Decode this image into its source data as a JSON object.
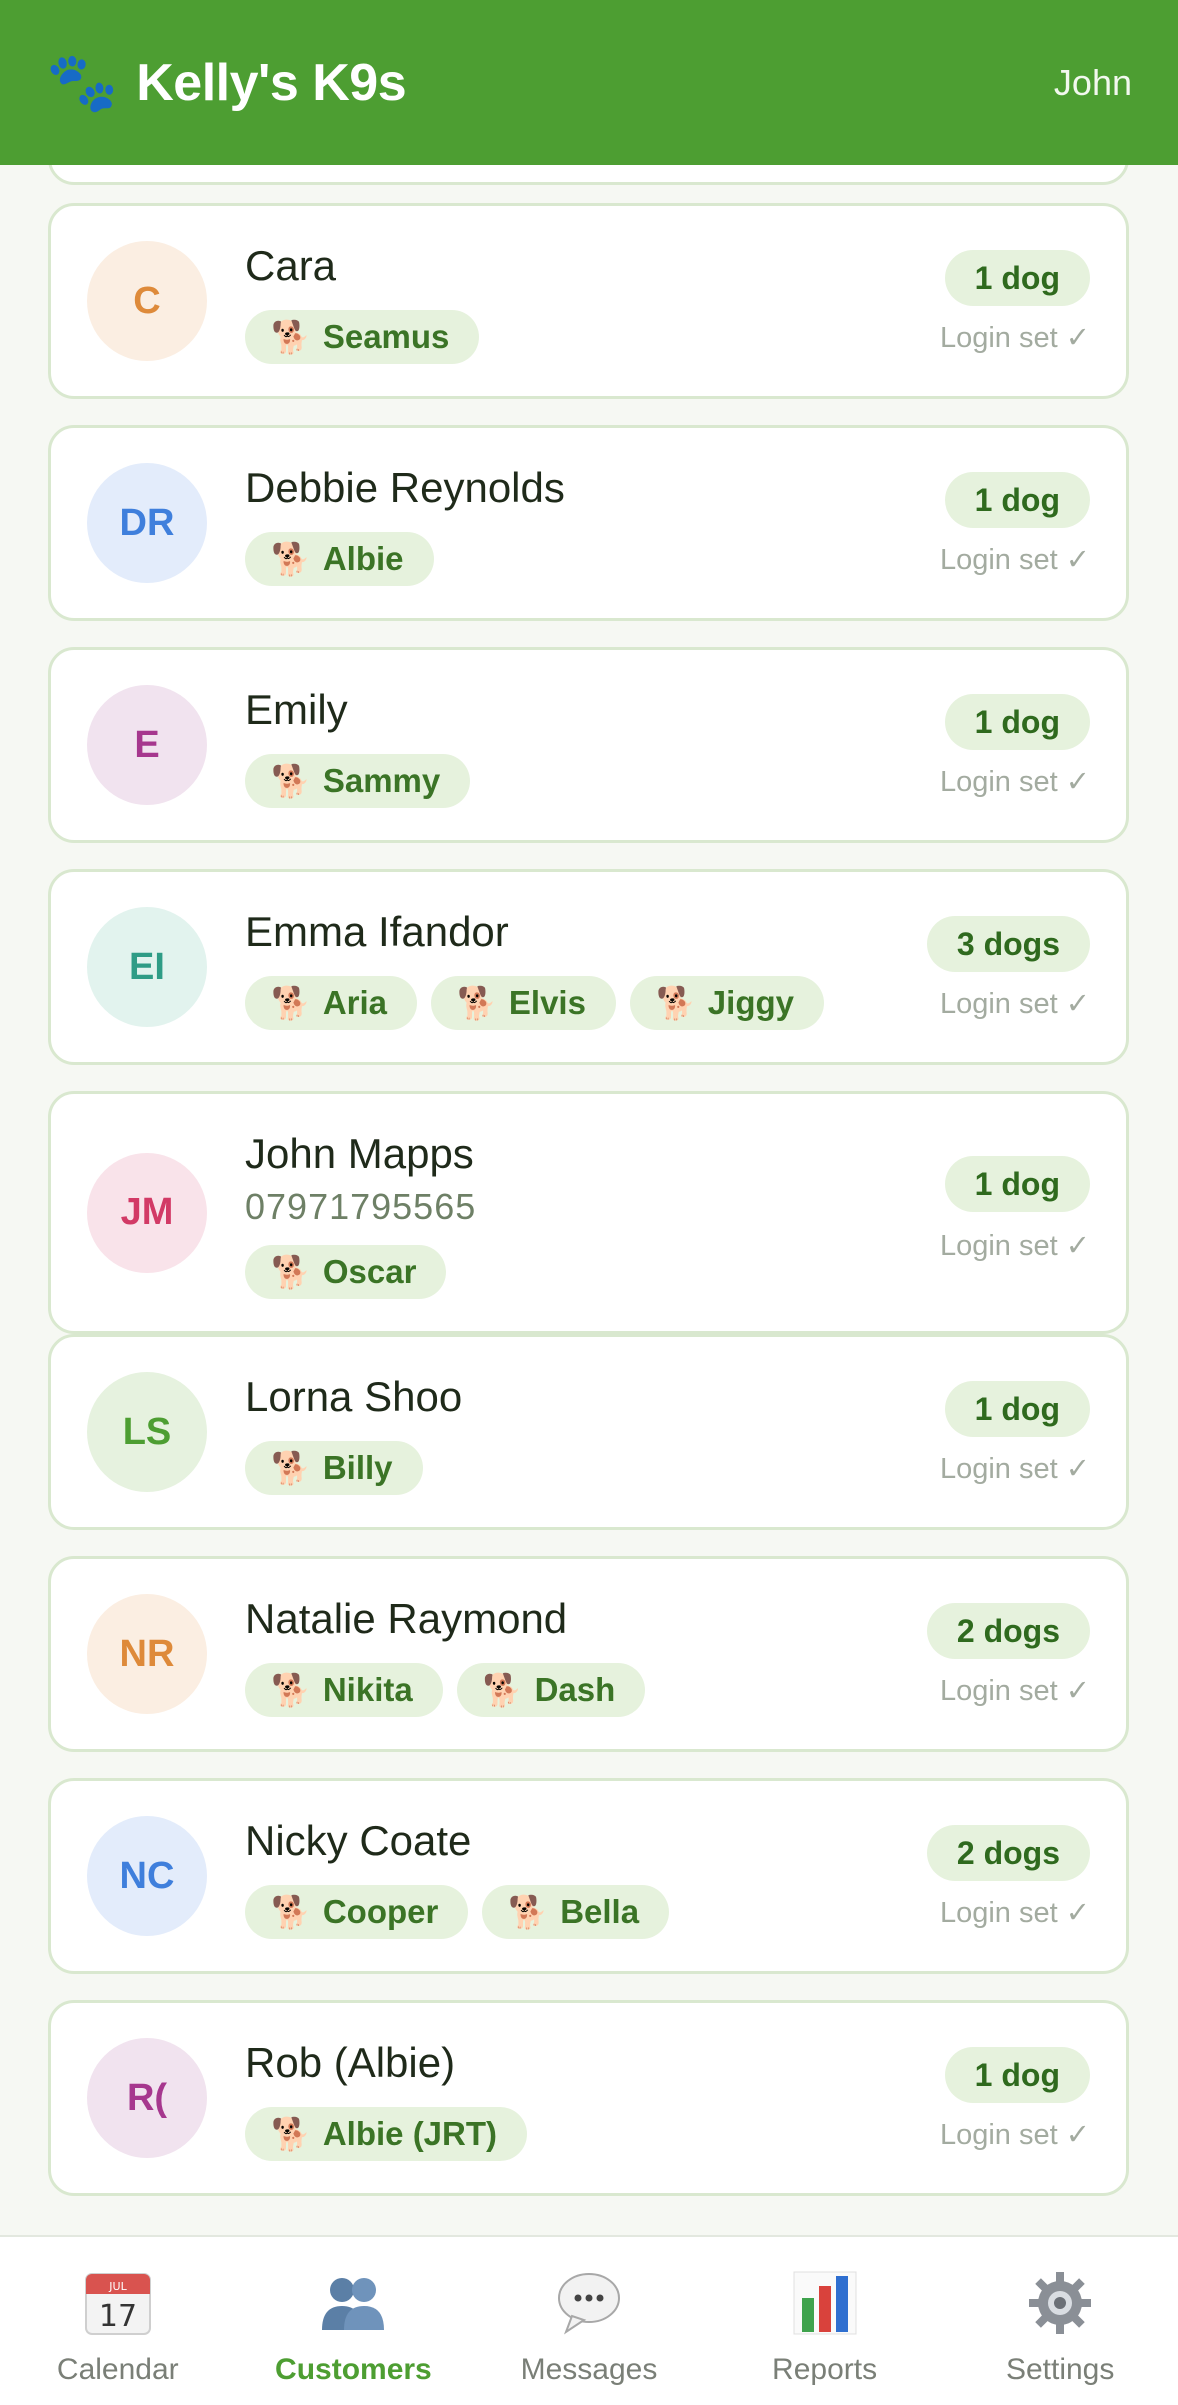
{
  "header": {
    "paw_icon": "paw-prints-icon",
    "title": "Kelly's K9s",
    "user": "John"
  },
  "customers": [
    {
      "initials": "C",
      "name": "Cara",
      "phone": "",
      "dogs": [
        "Seamus"
      ],
      "count": "1 dog",
      "login": "Login set ✓",
      "avatar_bg": "#fbeee2",
      "avatar_fg": "#de8a3a"
    },
    {
      "initials": "DR",
      "name": "Debbie Reynolds",
      "phone": "",
      "dogs": [
        "Albie"
      ],
      "count": "1 dog",
      "login": "Login set ✓",
      "avatar_bg": "#e3ecfb",
      "avatar_fg": "#3f7fdc"
    },
    {
      "initials": "E",
      "name": "Emily",
      "phone": "",
      "dogs": [
        "Sammy"
      ],
      "count": "1 dog",
      "login": "Login set ✓",
      "avatar_bg": "#f1e3ef",
      "avatar_fg": "#a6378e"
    },
    {
      "initials": "EI",
      "name": "Emma Ifandor",
      "phone": "",
      "dogs": [
        "Aria",
        "Elvis",
        "Jiggy"
      ],
      "count": "3 dogs",
      "login": "Login set ✓",
      "avatar_bg": "#e2f3ee",
      "avatar_fg": "#2f9c86"
    },
    {
      "initials": "JM",
      "name": "John Mapps",
      "phone": "07971795565",
      "dogs": [
        "Oscar"
      ],
      "count": "1 dog",
      "login": "Login set ✓",
      "avatar_bg": "#f9e3ea",
      "avatar_fg": "#d23a66"
    },
    {
      "initials": "LS",
      "name": "Lorna Shoo",
      "phone": "",
      "dogs": [
        "Billy"
      ],
      "count": "1 dog",
      "login": "Login set ✓",
      "avatar_bg": "#e6f2df",
      "avatar_fg": "#4d9e32"
    },
    {
      "initials": "NR",
      "name": "Natalie Raymond",
      "phone": "",
      "dogs": [
        "Nikita",
        "Dash"
      ],
      "count": "2 dogs",
      "login": "Login set ✓",
      "avatar_bg": "#fbeee2",
      "avatar_fg": "#de8a3a"
    },
    {
      "initials": "NC",
      "name": "Nicky Coate",
      "phone": "",
      "dogs": [
        "Cooper",
        "Bella"
      ],
      "count": "2 dogs",
      "login": "Login set ✓",
      "avatar_bg": "#e3ecfb",
      "avatar_fg": "#3f7fdc"
    },
    {
      "initials": "R(",
      "name": "Rob (Albie)",
      "phone": "",
      "dogs": [
        "Albie (JRT)"
      ],
      "count": "1 dog",
      "login": "Login set ✓",
      "avatar_bg": "#f1e3ef",
      "avatar_fg": "#a6378e"
    }
  ],
  "dog_icon": "dog-icon",
  "tabs": [
    {
      "label": "Calendar",
      "icon": "calendar-icon",
      "calendar_month": "JUL",
      "calendar_day": "17",
      "active": false
    },
    {
      "label": "Customers",
      "icon": "people-icon",
      "active": true
    },
    {
      "label": "Messages",
      "icon": "speech-bubble-icon",
      "active": false
    },
    {
      "label": "Reports",
      "icon": "bar-chart-icon",
      "active": false
    },
    {
      "label": "Settings",
      "icon": "gear-icon",
      "active": false
    }
  ],
  "colors": {
    "brand_green": "#4d9e32",
    "chip_bg": "#e6f2dd",
    "card_border": "#d9e8cf"
  }
}
